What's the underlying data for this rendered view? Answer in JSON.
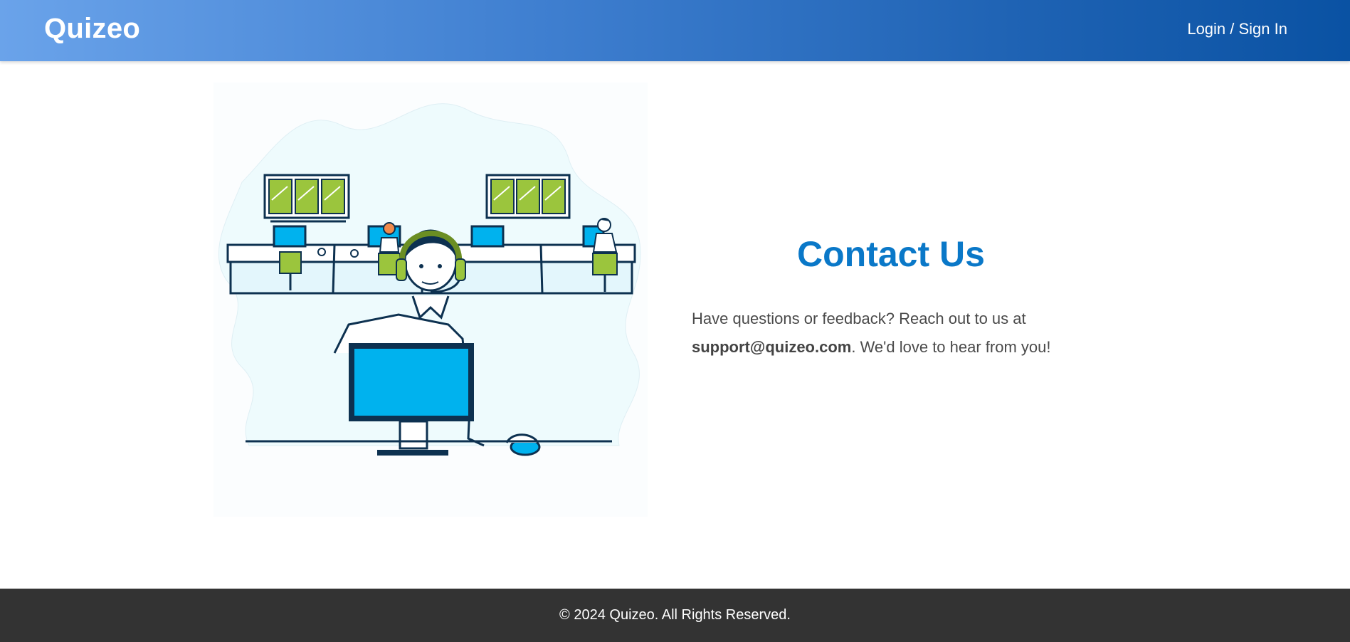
{
  "header": {
    "logo": "Quizeo",
    "login_label": "Login / Sign In"
  },
  "main": {
    "title": "Contact Us",
    "intro": "Have questions or feedback? Reach out to us at",
    "email": "support@quizeo.com",
    "outro": ". We'd love to hear from you!",
    "illustration": "customer-support-agent-illustration"
  },
  "footer": {
    "copyright": "© 2024 Quizeo. All Rights Reserved."
  },
  "colors": {
    "header_start": "#6aa3ea",
    "header_end": "#0a52a3",
    "title": "#0a78c8",
    "footer_bg": "#333333",
    "illustration_accent_green": "#9bc53d",
    "illustration_accent_blue": "#00b2ee",
    "illustration_outline": "#0d3150"
  }
}
